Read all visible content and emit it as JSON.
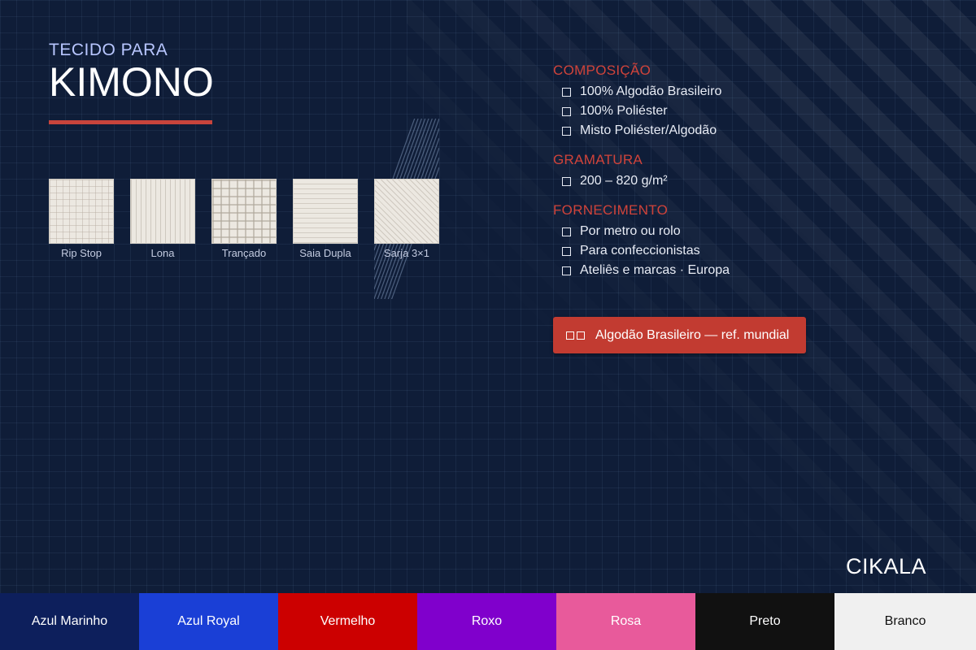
{
  "header": {
    "subtitle": "TECIDO PARA",
    "title": "KIMONO"
  },
  "weaves": [
    {
      "label": "Rip Stop",
      "texture": "ripstop"
    },
    {
      "label": "Lona",
      "texture": "lona"
    },
    {
      "label": "Trançado",
      "texture": "trancado"
    },
    {
      "label": "Saia Dupla",
      "texture": "saia"
    },
    {
      "label": "Sarja 3×1",
      "texture": "sarja"
    }
  ],
  "sections": [
    {
      "heading": "COMPOSIÇÃO",
      "items": [
        "100% Algodão Brasileiro",
        "100% Poliéster",
        "Misto Poliéster/Algodão"
      ]
    },
    {
      "heading": "GRAMATURA",
      "items": [
        "200 – 820 g/m²"
      ]
    },
    {
      "heading": "FORNECIMENTO",
      "items": [
        "Por metro ou rolo",
        "Para confeccionistas",
        "Ateliês e marcas · Europa"
      ]
    }
  ],
  "cta": {
    "label": "Algodão Brasileiro — ref. mundial",
    "color": "#c23b31"
  },
  "brand": "CIKALA",
  "colors": [
    {
      "name": "Azul Marinho",
      "hex": "#0d1f5c",
      "text": "#ffffff"
    },
    {
      "name": "Azul Royal",
      "hex": "#1a3fd6",
      "text": "#ffffff"
    },
    {
      "name": "Vermelho",
      "hex": "#cc0000",
      "text": "#ffffff"
    },
    {
      "name": "Roxo",
      "hex": "#8000cc",
      "text": "#ffffff"
    },
    {
      "name": "Rosa",
      "hex": "#e85a9b",
      "text": "#ffffff"
    },
    {
      "name": "Preto",
      "hex": "#111111",
      "text": "#ffffff"
    },
    {
      "name": "Branco",
      "hex": "#f0f0f0",
      "text": "#111111"
    }
  ],
  "accent": "#d0433a",
  "background": "#0f1d38"
}
